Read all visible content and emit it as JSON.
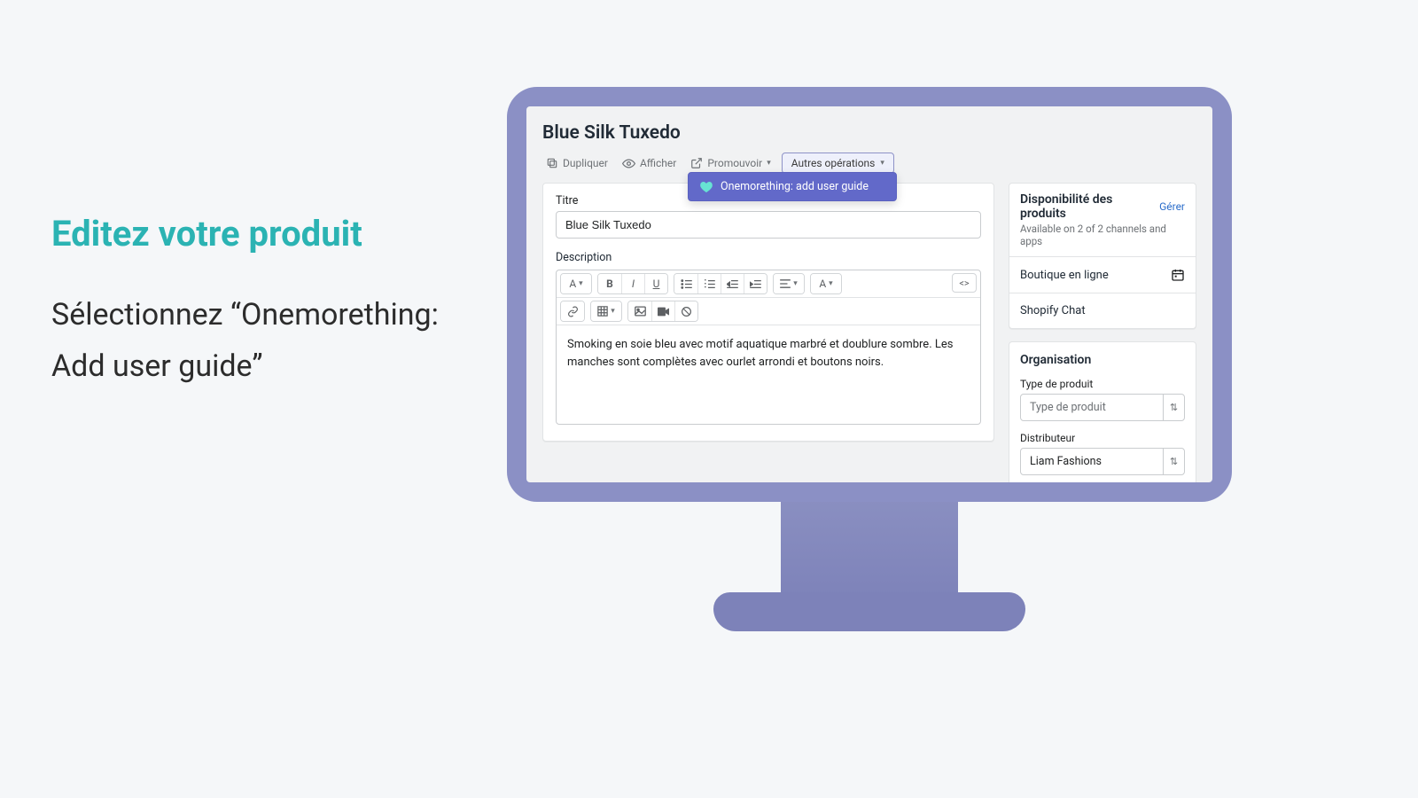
{
  "left_panel": {
    "title": "Editez votre produit",
    "subtitle": "Sélectionnez “Onemorething: Add user guide”"
  },
  "page": {
    "title": "Blue Silk Tuxedo",
    "actions": {
      "duplicate": "Dupliquer",
      "view": "Afficher",
      "promote": "Promouvoir",
      "more": "Autres opérations"
    },
    "dropdown_item": "Onemorething: add user guide"
  },
  "product_form": {
    "title_label": "Titre",
    "title_value": "Blue Silk Tuxedo",
    "description_label": "Description",
    "description_value": "Smoking en soie bleu avec motif aquatique marbré et doublure sombre. Les manches sont complètes avec ourlet arrondi et boutons noirs."
  },
  "availability": {
    "heading": "Disponibilité des produits",
    "manage": "Gérer",
    "subtext": "Available on 2 of 2 channels and apps",
    "rows": {
      "online_store": "Boutique en ligne",
      "chat": "Shopify Chat"
    }
  },
  "organization": {
    "heading": "Organisation",
    "product_type_label": "Type de produit",
    "product_type_placeholder": "Type de produit",
    "vendor_label": "Distributeur",
    "vendor_value": "Liam Fashions"
  }
}
